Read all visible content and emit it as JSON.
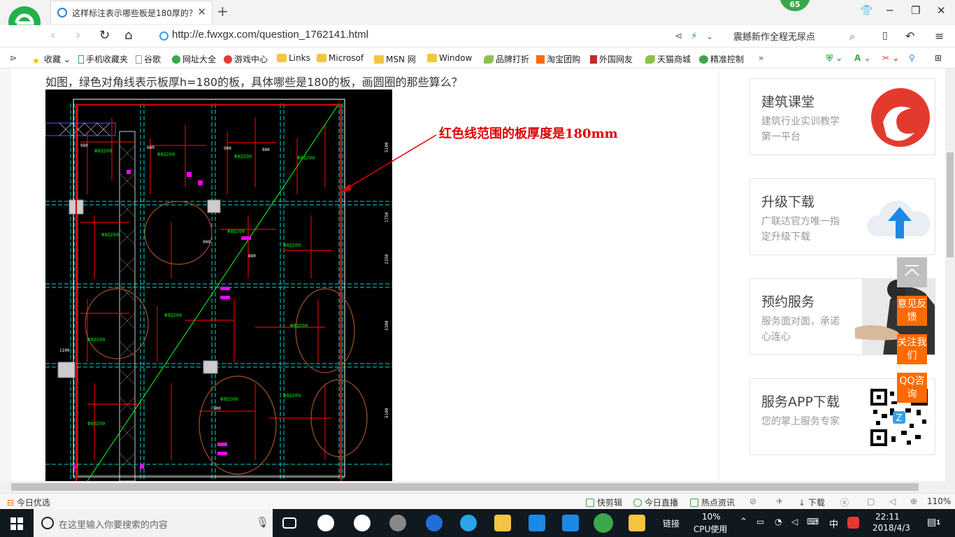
{
  "browser": {
    "tab_title": "这样标注表示哪些板是180厚的？",
    "notification_count": "65",
    "url": "http://e.fwxgx.com/question_1762141.html",
    "search_suggestion": "震撼新作全程无尿点",
    "zoom": "110%"
  },
  "bookmarks": [
    {
      "label": "收藏",
      "icon": "star-icon"
    },
    {
      "label": "手机收藏夹",
      "icon": "phone-icon"
    },
    {
      "label": "谷歌",
      "icon": "page-icon"
    },
    {
      "label": "网址大全",
      "icon": "globe-icon"
    },
    {
      "label": "游戏中心",
      "icon": "game-icon"
    },
    {
      "label": "Links",
      "icon": "folder-icon"
    },
    {
      "label": "Microsof",
      "icon": "folder-icon"
    },
    {
      "label": "MSN 网",
      "icon": "folder-icon"
    },
    {
      "label": "Window",
      "icon": "folder-icon"
    },
    {
      "label": "品牌打折",
      "icon": "leaf-icon"
    },
    {
      "label": "淘宝团购",
      "icon": "taobao-icon"
    },
    {
      "label": "外国网友",
      "icon": "bookmark-icon"
    },
    {
      "label": "天猫商城",
      "icon": "leaf-icon"
    },
    {
      "label": "精准控制",
      "icon": "wechat-icon"
    }
  ],
  "question": {
    "text": "如图，绿色对角线表示板厚h=180的板，具体哪些是180的板，画圆圈的那些算么？",
    "annotation": "红色线范围的板厚度是180mm"
  },
  "sidebar_cards": [
    {
      "title": "建筑课堂",
      "subtitle": "建筑行业实训教学第一平台",
      "icon": "brand-logo-icon"
    },
    {
      "title": "升级下载",
      "subtitle": "广联达官方唯一指定升级下载",
      "icon": "cloud-upload-icon"
    },
    {
      "title": "预约服务",
      "subtitle": "服务面对面，承诺心连心",
      "icon": "handshake-photo"
    },
    {
      "title": "服务APP下载",
      "subtitle": "您的掌上服务专家",
      "icon": "qr-code-icon"
    }
  ],
  "float_buttons": [
    {
      "label": "意见反馈"
    },
    {
      "label": "关注我们"
    },
    {
      "label": "QQ咨询"
    }
  ],
  "statusbar": {
    "left": "今日优选",
    "items": [
      "快剪辑",
      "今日直播",
      "热点资讯"
    ],
    "download": "下载",
    "zoom": "110%"
  },
  "taskbar": {
    "search_placeholder": "在这里输入你要搜索的内容",
    "links_label": "链接",
    "cpu_percent": "10%",
    "cpu_label": "CPU使用",
    "ime": "中",
    "time": "22:11",
    "date": "2018/4/3",
    "notifications": "1"
  }
}
